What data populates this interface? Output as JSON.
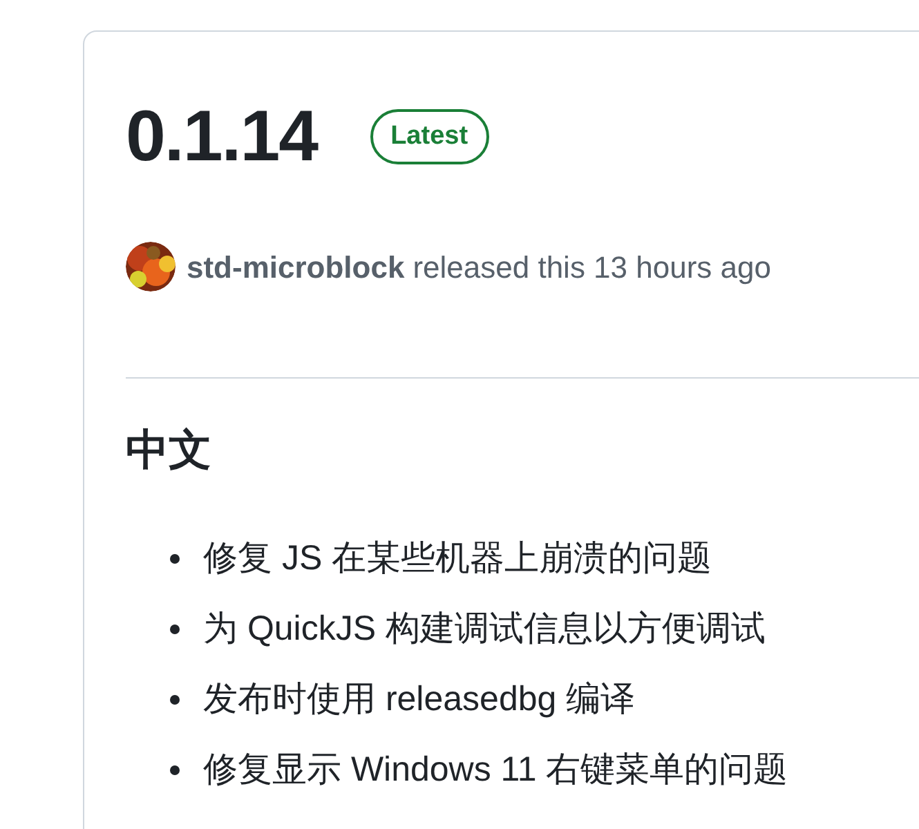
{
  "release": {
    "version": "0.1.14",
    "badge": "Latest",
    "author": "std-microblock",
    "released_text": "released this 13 hours ago"
  },
  "notes": {
    "heading": "中文",
    "items": [
      "修复 JS 在某些机器上崩溃的问题",
      "为 QuickJS 构建调试信息以方便调试",
      "发布时使用 releasedbg 编译",
      "修复显示 Windows 11 右键菜单的问题"
    ]
  }
}
